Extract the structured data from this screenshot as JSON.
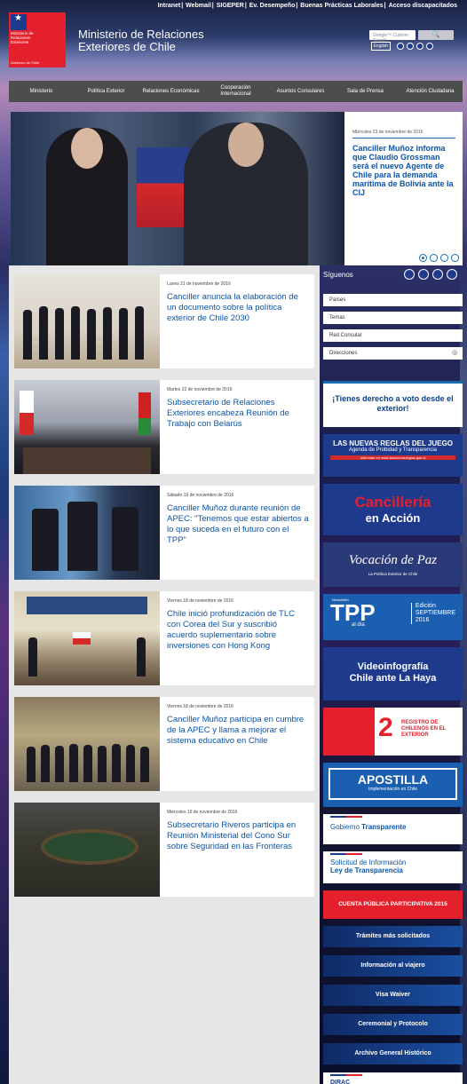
{
  "top_links": [
    "Intranet",
    "Webmail",
    "SIGEPER",
    "Ev. Desempeño",
    "Buenas Prácticas Laborales",
    "Acceso discapacitados"
  ],
  "logo": {
    "line1": "Ministerio de",
    "line2": "Relaciones",
    "line3": "Exteriores",
    "gov": "Gobierno de Chile"
  },
  "site_title_line1": "Ministerio de Relaciones",
  "site_title_line2": "Exteriores de Chile",
  "search": {
    "placeholder": "Google™ Custom Search",
    "button": "🔍"
  },
  "language": "English",
  "nav": [
    "Ministerio",
    "Política Exterior",
    "Relaciones Económicas",
    "Cooperación Internacional",
    "Asuntos Consulares",
    "Sala de Prensa",
    "Atención Ciudadana"
  ],
  "hero": {
    "date": "Miércoles 23 de noviembre de 2016",
    "title": "Canciller Muñoz informa que Claudio Grossman será el nuevo Agente de Chile para la demanda marítima de Bolivia ante la CIJ"
  },
  "news": [
    {
      "date": "Lunes 21 de noviembre de 2016",
      "title": "Canciller anuncia la elaboración de un documento sobre la política exterior de Chile 2030"
    },
    {
      "date": "Martes 22 de noviembre de 2016",
      "title": "Subsecretario de Relaciones Exteriores encabeza Reunión de Trabajo con Belarús"
    },
    {
      "date": "Sábado 19 de noviembre de 2016",
      "title": "Canciller Muñoz durante reunión de APEC: \"Tenemos que estar abiertos a lo que suceda en el futuro con el TPP\""
    },
    {
      "date": "Viernes 18 de noviembre de 2016",
      "title": "Chile inició profundización de TLC con Corea del Sur y suscribió acuerdo suplementario sobre inversiones con Hong Kong"
    },
    {
      "date": "Viernes 18 de noviembre de 2016",
      "title": "Canciller Muñoz participa en cumbre de la APEC y llama a mejorar el sistema educativo en Chile"
    },
    {
      "date": "Miércoles 16 de noviembre de 2016",
      "title": "Subsecretario Riveros participa en Reunión Ministerial del Cono Sur sobre Seguridad en las Fronteras"
    }
  ],
  "sidebar": {
    "follow": "Síguenos",
    "accordion": [
      "Países",
      "Temas",
      "Red Consular",
      "Direcciones"
    ],
    "banners": {
      "vote": "¡Tienes derecho a voto desde el exterior!",
      "rules_big": "LAS NUEVAS REGLAS DEL JUEGO",
      "rules_sub": "Agenda de Probidad y Transparencia",
      "rules_url": "Infórmate en www.lasnuevasreglas.gob.cl",
      "cancilleria1": "Cancillería",
      "cancilleria2": "en Acción",
      "vocacion": "Vocación de Paz",
      "vocacion_sub": "La Política Exterior de Chile",
      "tpp_newsletter": "Newsletter",
      "tpp": "TPP",
      "tpp_al_dia": "al día",
      "tpp_edicion": "Edición",
      "tpp_month": "SEPTIEMBRE",
      "tpp_year": "2016",
      "video1": "Videoinfografía",
      "video2": "Chile ante La Haya",
      "registro_chile": "Chile",
      "registro_num": "2",
      "registro": "REGISTRO DE CHILENOS EN EL EXTERIOR",
      "apostilla": "APOSTILLA",
      "apostilla_sub": "Implementación en Chile"
    },
    "gob_transparente_1": "Gobierno",
    "gob_transparente_2": "Transparente",
    "solicitud_1": "Solicitud de Información",
    "solicitud_2": "Ley de Transparencia",
    "cuenta_publica": "CUENTA PÚBLICA PARTICIPATIVA 2015",
    "links": [
      "Trámites más solicitados",
      "Información al viajero",
      "Visa Waiver",
      "Ceremonial y Protocolo",
      "Archivo General Histórico"
    ],
    "dirac": "DIRAC"
  }
}
